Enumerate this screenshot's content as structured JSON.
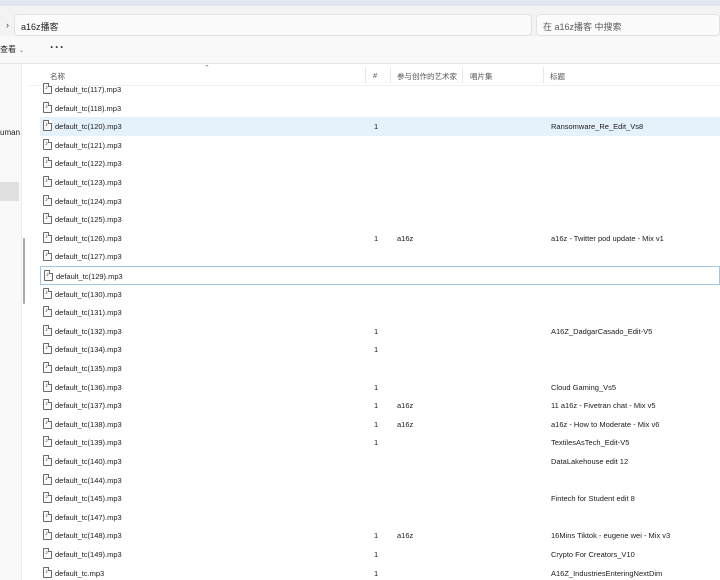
{
  "address": {
    "path": "a16z播客"
  },
  "search": {
    "placeholder": "在 a16z播客 中搜索"
  },
  "toolbar": {
    "view_label": "查看",
    "more_label": "···"
  },
  "nav": {
    "fragment": "uman"
  },
  "columns": {
    "name": "名称",
    "number": "#",
    "artist": "参与创作的艺术家",
    "album": "唱片集",
    "title": "标题"
  },
  "files": [
    {
      "name": "default_tc(117).mp3",
      "num": "",
      "artist": "",
      "title": ""
    },
    {
      "name": "default_tc(118).mp3",
      "num": "",
      "artist": "",
      "title": ""
    },
    {
      "name": "default_tc(120).mp3",
      "num": "1",
      "artist": "",
      "title": "Ransomware_Re_Edit_Vs8"
    },
    {
      "name": "default_tc(121).mp3",
      "num": "",
      "artist": "",
      "title": ""
    },
    {
      "name": "default_tc(122).mp3",
      "num": "",
      "artist": "",
      "title": ""
    },
    {
      "name": "default_tc(123).mp3",
      "num": "",
      "artist": "",
      "title": ""
    },
    {
      "name": "default_tc(124).mp3",
      "num": "",
      "artist": "",
      "title": ""
    },
    {
      "name": "default_tc(125).mp3",
      "num": "",
      "artist": "",
      "title": ""
    },
    {
      "name": "default_tc(126).mp3",
      "num": "1",
      "artist": "a16z",
      "title": "a16z - Twitter pod update - Mix v1"
    },
    {
      "name": "default_tc(127).mp3",
      "num": "",
      "artist": "",
      "title": ""
    },
    {
      "name": "default_tc(129).mp3",
      "num": "",
      "artist": "",
      "title": ""
    },
    {
      "name": "default_tc(130).mp3",
      "num": "",
      "artist": "",
      "title": ""
    },
    {
      "name": "default_tc(131).mp3",
      "num": "",
      "artist": "",
      "title": ""
    },
    {
      "name": "default_tc(132).mp3",
      "num": "1",
      "artist": "",
      "title": "A16Z_DadgarCasado_Edit-V5"
    },
    {
      "name": "default_tc(134).mp3",
      "num": "1",
      "artist": "",
      "title": ""
    },
    {
      "name": "default_tc(135).mp3",
      "num": "",
      "artist": "",
      "title": ""
    },
    {
      "name": "default_tc(136).mp3",
      "num": "1",
      "artist": "",
      "title": "Cloud Gaming_Vs5"
    },
    {
      "name": "default_tc(137).mp3",
      "num": "1",
      "artist": "a16z",
      "title": "11 a16z - Fivetran chat - Mix v5"
    },
    {
      "name": "default_tc(138).mp3",
      "num": "1",
      "artist": "a16z",
      "title": "a16z - How to Moderate - Mix v6"
    },
    {
      "name": "default_tc(139).mp3",
      "num": "1",
      "artist": "",
      "title": "TextilesAsTech_Edit-V5"
    },
    {
      "name": "default_tc(140).mp3",
      "num": "",
      "artist": "",
      "title": "DataLakehouse edit 12"
    },
    {
      "name": "default_tc(144).mp3",
      "num": "",
      "artist": "",
      "title": ""
    },
    {
      "name": "default_tc(145).mp3",
      "num": "",
      "artist": "",
      "title": "Fintech for Student edit 8"
    },
    {
      "name": "default_tc(147).mp3",
      "num": "",
      "artist": "",
      "title": ""
    },
    {
      "name": "default_tc(148).mp3",
      "num": "1",
      "artist": "a16z",
      "title": "16Mins Tiktok - eugene wei - Mix v3"
    },
    {
      "name": "default_tc(149).mp3",
      "num": "1",
      "artist": "",
      "title": "Crypto For Creators_V10"
    },
    {
      "name": "default_tc.mp3",
      "num": "1",
      "artist": "",
      "title": "A16Z_IndustriesEnteringNextDim"
    }
  ],
  "colors": {
    "selected_row": "#e5f1fb",
    "focus_border": "#9fc7e8"
  }
}
